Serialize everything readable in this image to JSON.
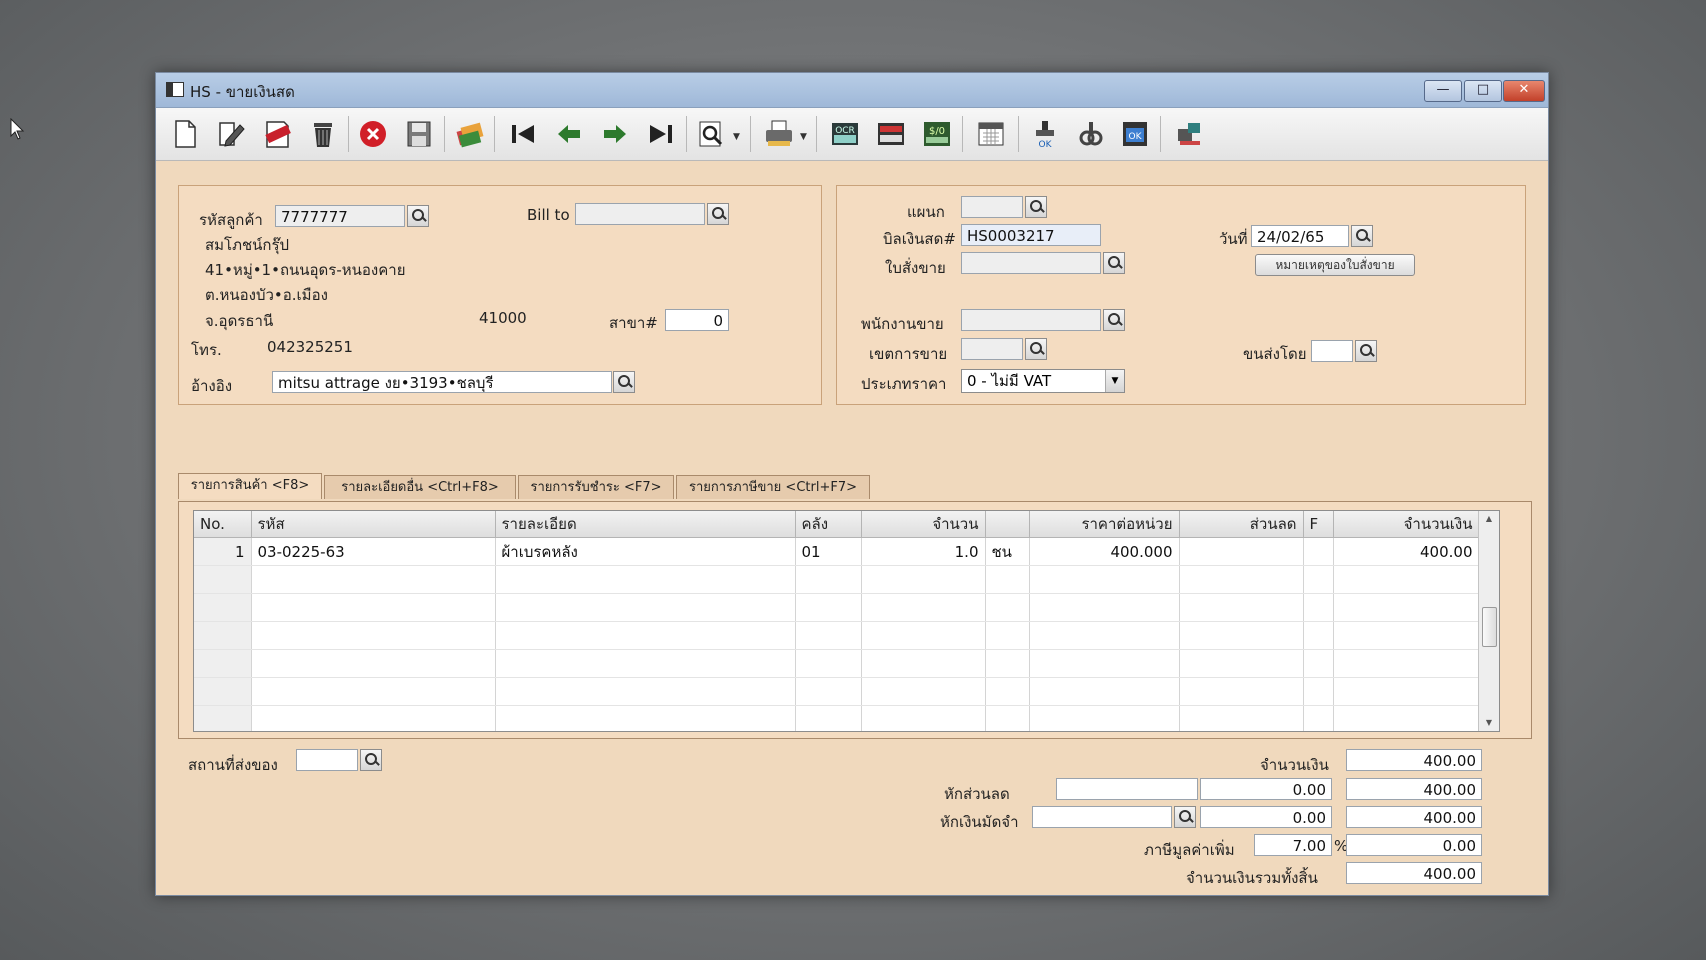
{
  "window": {
    "title": "HS - ขายเงินสด",
    "minimize": "—",
    "maximize": "□",
    "close": "✕"
  },
  "toolbar": {
    "icons": [
      "new-icon",
      "edit-icon",
      "void-icon",
      "delete-icon",
      "cancel-icon",
      "save-icon",
      "copy-icon",
      "first-record-icon",
      "previous-record-icon",
      "next-record-icon",
      "last-record-icon",
      "search-record-icon",
      "print-icon",
      "ocr-icon",
      "slip-icon",
      "dollar-icon",
      "calendar-icon",
      "approve-icon",
      "link-icon",
      "ok-icon",
      "network-icon"
    ],
    "ocr_label": "OCR",
    "dollar_label": "$/0"
  },
  "customer": {
    "code_label": "รหัสลูกค้า",
    "code": "7777777",
    "bill_to_label": "Bill to",
    "bill_to": "",
    "name": "สมโภชน์กรุ๊ป",
    "address1": "41•หมู่•1•ถนนอุดร-หนองคาย",
    "address2": "ต.หนองบัว•อ.เมือง",
    "province": "จ.อุดรธานี",
    "postcode": "41000",
    "branch_label": "สาขา#",
    "branch": "0",
    "phone_label": "โทร.",
    "phone": "042325251",
    "ref_label": "อ้างอิง",
    "ref": "mitsu attrage งย•3193•ชลบุรี"
  },
  "doc": {
    "dept_label": "แผนก",
    "dept": "",
    "bill_no_label": "บิลเงินสด#",
    "bill_no": "HS0003217",
    "date_label": "วันที่",
    "date": "24/02/65",
    "order_label": "ใบสั่งขาย",
    "order": "",
    "order_note_button": "หมายเหตุของใบสั่งขาย",
    "salesman_label": "พนักงานขาย",
    "salesman": "",
    "area_label": "เขตการขาย",
    "area": "",
    "ship_by_label": "ขนส่งโดย",
    "ship_by": "",
    "price_type_label": "ประเภทราคา",
    "price_type": "0 - ไม่มี VAT"
  },
  "tabs": [
    {
      "label": "รายการสินค้า <F8>"
    },
    {
      "label": "รายละเอียดอื่น <Ctrl+F8>"
    },
    {
      "label": "รายการรับชำระ <F7>"
    },
    {
      "label": "รายการภาษีขาย <Ctrl+F7>"
    }
  ],
  "grid": {
    "columns": [
      "No.",
      "รหัส",
      "รายละเอียด",
      "คลัง",
      "จำนวน",
      "",
      "ราคาต่อหน่วย",
      "ส่วนลด",
      "F",
      "จำนวนเงิน"
    ],
    "rows": [
      {
        "no": "1",
        "code": "03-0225-63",
        "desc": "ผ้าเบรคหลัง",
        "wh": "01",
        "qty": "1.0",
        "unit": "ชน",
        "price": "400.000",
        "disc": "",
        "f": "",
        "amount": "400.00"
      }
    ]
  },
  "footer": {
    "ship_place_label": "สถานที่ส่งของ",
    "ship_place": "",
    "amount_label": "จำนวนเงิน",
    "amount": "400.00",
    "discount_label": "หักส่วนลด",
    "discount_input": "",
    "discount_value": "0.00",
    "after_discount": "400.00",
    "deposit_label": "หักเงินมัดจำ",
    "deposit_input": "",
    "deposit_value": "0.00",
    "after_deposit": "400.00",
    "vat_label": "ภาษีมูลค่าเพิ่ม",
    "vat_rate": "7.00",
    "vat_pct": "%",
    "vat_amount": "0.00",
    "total_label": "จำนวนเงินรวมทั้งสิ้น",
    "total": "400.00"
  }
}
